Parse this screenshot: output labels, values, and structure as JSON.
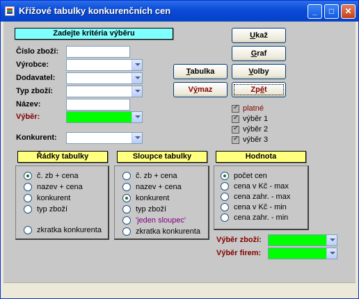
{
  "window": {
    "title": "Křížové tabulky konkurenčních cen",
    "minimize": "_",
    "maximize": "□",
    "close": "✕"
  },
  "criteria": {
    "header": "Zadejte kritéria výběru",
    "fields": {
      "cislo_zbozi": {
        "label": "Číslo zboží:",
        "value": ""
      },
      "vyrobce": {
        "label": "Výrobce:",
        "value": ""
      },
      "dodavatel": {
        "label": "Dodavatel:",
        "value": ""
      },
      "typ_zbozi": {
        "label": "Typ zboží:",
        "value": ""
      },
      "nazev": {
        "label": "Název:",
        "value": ""
      },
      "vyber": {
        "label": "Výběr:",
        "value": ""
      },
      "konkurent": {
        "label": "Konkurent:",
        "value": ""
      }
    }
  },
  "buttons": {
    "ukaz": {
      "ul": "U",
      "rest": "kaž"
    },
    "graf": {
      "ul": "G",
      "rest": "raf"
    },
    "tabulka": {
      "ul": "T",
      "rest": "abulka"
    },
    "volby": {
      "ul": "V",
      "rest": "olby"
    },
    "vymaz_pre": "V",
    "vymaz_ul": "ý",
    "vymaz_post": "maz",
    "zpet_pre": "Zp",
    "zpet_ul": "ě",
    "zpet_post": "t"
  },
  "checkboxes": [
    {
      "label": "platné",
      "checked": true,
      "accent": "#800000"
    },
    {
      "label": "výběr 1",
      "checked": true
    },
    {
      "label": "výběr 2",
      "checked": true
    },
    {
      "label": "výběr 3",
      "checked": true
    }
  ],
  "groups": {
    "radky": {
      "header": "Řádky tabulky",
      "options": [
        "č. zb + cena",
        "nazev + cena",
        "konkurent",
        "typ zboží",
        "zkratka konkurenta"
      ],
      "selected": "č. zb + cena"
    },
    "sloupce": {
      "header": "Sloupce tabulky",
      "options": [
        "č. zb + cena",
        "nazev + cena",
        "konkurent",
        "typ zboží",
        "'jeden sloupec'",
        "zkratka konkurenta"
      ],
      "selected": "konkurent"
    },
    "hodnota": {
      "header": "Hodnota",
      "options": [
        "počet cen",
        "cena v Kč - max",
        "cena zahr. - max",
        "cena v Kč - min",
        "cena zahr. - min"
      ],
      "selected": "počet cen"
    }
  },
  "bottom": {
    "vyber_zbozi": {
      "label": "Výběr zboží:",
      "value": ""
    },
    "vyber_firem": {
      "label": "Výběr firem:",
      "value": ""
    }
  },
  "colors": {
    "header_cyan": "#80ffff",
    "header_yellow": "#ffff80",
    "highlight_green": "#00ff00",
    "label_red": "#800000"
  }
}
